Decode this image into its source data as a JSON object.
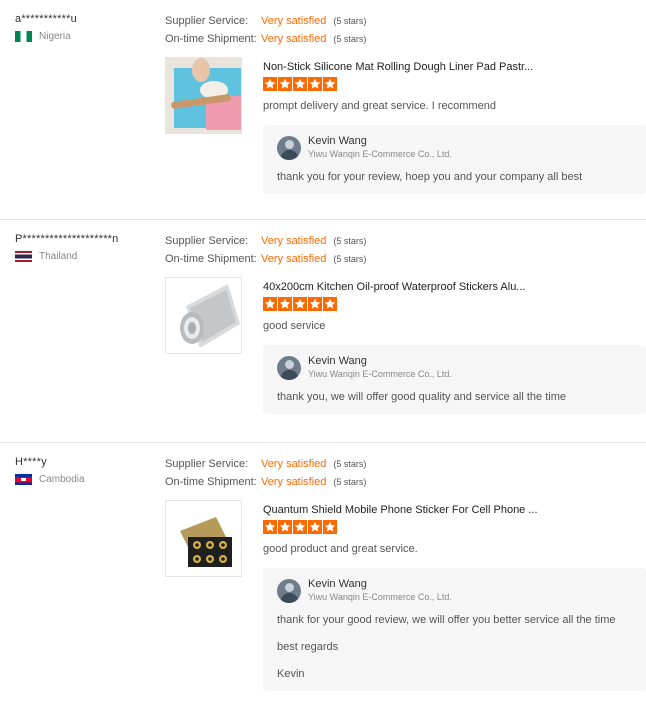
{
  "labels": {
    "supplier_service": "Supplier Service:",
    "ontime_shipment": "On-time Shipment:"
  },
  "colors": {
    "accent": "#ff6a00",
    "reply_bg": "#f6f6f6"
  },
  "reviews": [
    {
      "buyer": "a***********u",
      "country": "Nigeria",
      "flag_icon": "nigeria-flag-icon",
      "supplier_service": {
        "value": "Very satisfied",
        "stars": "(5 stars)"
      },
      "ontime_shipment": {
        "value": "Very satisfied",
        "stars": "(5 stars)"
      },
      "product_title": "Non-Stick Silicone Mat Rolling Dough Liner Pad Pastr...",
      "product_rating": 5,
      "comment": "prompt delivery and great service. I recommend",
      "reply": {
        "seller": "Kevin Wang",
        "company": "Yiwu Wanqin E-Commerce Co., Ltd.",
        "lines": [
          "thank you for your review, hoep you and your company all best"
        ]
      }
    },
    {
      "buyer": "P********************n",
      "country": "Thailand",
      "flag_icon": "thailand-flag-icon",
      "supplier_service": {
        "value": "Very satisfied",
        "stars": "(5 stars)"
      },
      "ontime_shipment": {
        "value": "Very satisfied",
        "stars": "(5 stars)"
      },
      "product_title": "40x200cm Kitchen Oil-proof Waterproof Stickers Alu...",
      "product_rating": 5,
      "comment": "good service",
      "reply": {
        "seller": "Kevin Wang",
        "company": "Yiwu Wanqin E-Commerce Co., Ltd.",
        "lines": [
          "thank you, we will offer good quality and service all the time"
        ]
      }
    },
    {
      "buyer": "H****y",
      "country": "Cambodia",
      "flag_icon": "cambodia-flag-icon",
      "supplier_service": {
        "value": "Very satisfied",
        "stars": "(5 stars)"
      },
      "ontime_shipment": {
        "value": "Very satisfied",
        "stars": "(5 stars)"
      },
      "product_title": "Quantum Shield Mobile Phone Sticker For Cell Phone ...",
      "product_rating": 5,
      "comment": "good product and great service.",
      "reply": {
        "seller": "Kevin Wang",
        "company": "Yiwu Wanqin E-Commerce Co., Ltd.",
        "lines": [
          "thank for your good review, we will offer you better service all the time",
          "best regards",
          "Kevin"
        ]
      }
    }
  ]
}
